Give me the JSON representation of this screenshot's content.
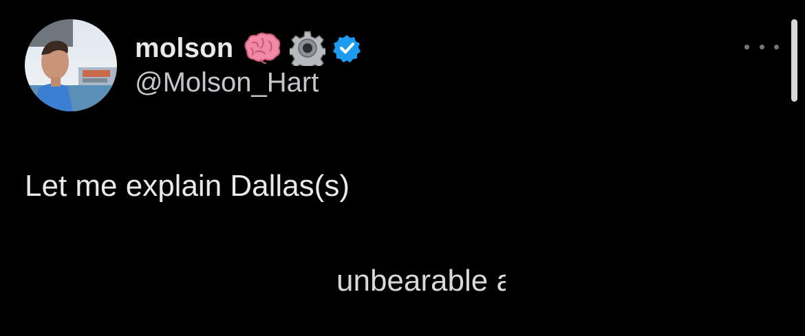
{
  "tweet": {
    "author": {
      "display_name": "molson",
      "handle": "@Molson_Hart",
      "emoji": [
        "brain-emoji",
        "gear-emoji"
      ],
      "verified_badge": "verified-badge-icon",
      "avatar_icon": "profile-photo"
    },
    "more_icon": "more-options-icon",
    "text": "Let me explain Dallas(s)",
    "media_text": {
      "visible": "unbearable",
      "cut_fragment": "a"
    }
  },
  "colors": {
    "background": "#000000",
    "text_primary": "#e7e9ea",
    "text_secondary": "#c4c7ca",
    "verified_blue": "#1d9bf0"
  }
}
